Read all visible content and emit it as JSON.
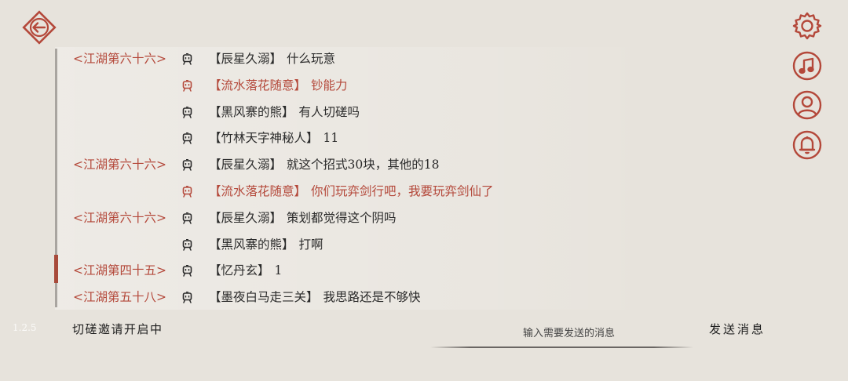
{
  "app": {
    "version": "1.2.5"
  },
  "colors": {
    "accent": "#b4483a",
    "text": "#2a2a2a",
    "background": "#e7e3dc"
  },
  "nav": {
    "back_icon": "back-arrow-icon"
  },
  "side_icons": [
    "gear-icon",
    "music-note-icon",
    "user-icon",
    "bell-icon"
  ],
  "chat": {
    "messages": [
      {
        "channel": "<江湖第六十六>",
        "speaker": "【辰星久溺】",
        "text": "什么玩意",
        "highlight": false
      },
      {
        "channel": "",
        "speaker": "【流水落花随意】",
        "text": "钞能力",
        "highlight": true
      },
      {
        "channel": "",
        "speaker": "【黑风寨的熊】",
        "text": "有人切磋吗",
        "highlight": false
      },
      {
        "channel": "",
        "speaker": "【竹林天字神秘人】",
        "text": "11",
        "highlight": false
      },
      {
        "channel": "<江湖第六十六>",
        "speaker": "【辰星久溺】",
        "text": "就这个招式30块，其他的18",
        "highlight": false
      },
      {
        "channel": "",
        "speaker": "【流水落花随意】",
        "text": "你们玩弈剑行吧，我要玩弈剑仙了",
        "highlight": true
      },
      {
        "channel": "<江湖第六十六>",
        "speaker": "【辰星久溺】",
        "text": "策划都觉得这个阴吗",
        "highlight": false
      },
      {
        "channel": "",
        "speaker": "【黑风寨的熊】",
        "text": "打啊",
        "highlight": false
      },
      {
        "channel": "<江湖第四十五>",
        "speaker": "【忆丹玄】",
        "text": "1",
        "highlight": false
      },
      {
        "channel": "<江湖第五十八>",
        "speaker": "【墨夜白马走三关】",
        "text": "我思路还是不够快",
        "highlight": false
      }
    ]
  },
  "footer": {
    "invite_status": "切磋邀请开启中",
    "input_placeholder": "输入需要发送的消息",
    "send_label": "发送消息"
  }
}
